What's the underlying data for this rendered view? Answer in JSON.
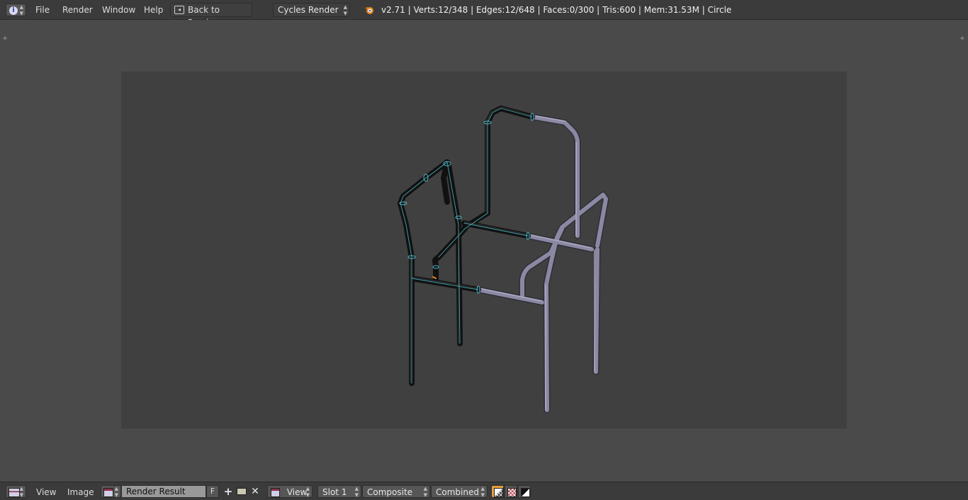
{
  "top_header": {
    "menus": [
      "File",
      "Render",
      "Window",
      "Help"
    ],
    "back_button_label": "Back to Previous",
    "render_engine": "Cycles Render",
    "stats": "v2.71 | Verts:12/348 | Edges:12/648 | Faces:0/300 | Tris:600 | Mem:31.53M | Circle"
  },
  "bottom_header": {
    "menus": [
      "View",
      "Image"
    ],
    "image_name": "Render Result",
    "fake_user_label": "F",
    "view_label": "View",
    "slot": "Slot 1",
    "render_layer": "Composite",
    "render_pass": "Combined"
  },
  "icons": {
    "info": "info-icon",
    "editor_type": "image-editor-icon",
    "blender_logo": "blender-logo-icon",
    "new_image": "plus-icon",
    "open_image": "folder-icon",
    "unlink": "close-icon",
    "alpha": "alpha-checker-icon",
    "z_buffer": "z-buffer-icon"
  },
  "colors": {
    "header_bg": "#3b3b3b",
    "viewport_bg": "#4a4a4a",
    "render_bg": "#404040",
    "accent_orange": "#e8841f",
    "active_toggle": "#e7a13b",
    "selected_wire": "#4fb8c6",
    "chair_gray": "#8a88a3"
  }
}
